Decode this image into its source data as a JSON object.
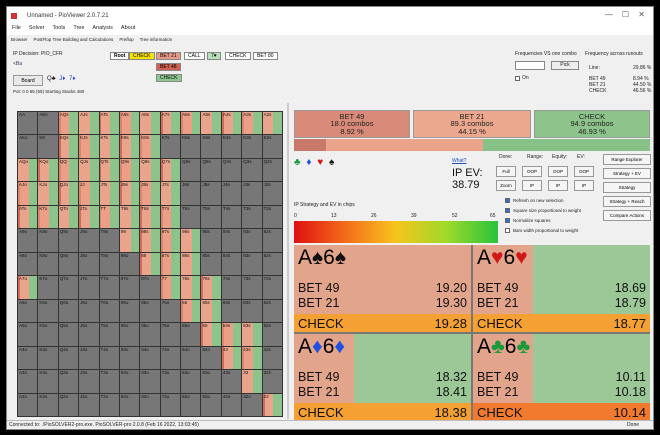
{
  "window": {
    "title": "Unnamed - PioViewer 2.0.7.21",
    "controls": [
      "—",
      "☐",
      "✕"
    ]
  },
  "menu": [
    "File",
    "Solver",
    "Tools",
    "Tree",
    "Analysis",
    "About"
  ],
  "tabs": [
    "Browser",
    "PostFlop Tree Building and Calculations",
    "Preflop",
    "Tree information"
  ],
  "info": {
    "decision": "IP Decision:  PIO_CFR",
    "decision_sub": "<Ba",
    "board_button": "Board",
    "board": [
      {
        "text": "Q♣",
        "color": "#111"
      },
      {
        "text": "J♦",
        "color": "#2040d0"
      },
      {
        "text": "7♦",
        "color": "#2040d0"
      }
    ],
    "pot": "Pot: 0 0 65 (65) Starting Stacks 480"
  },
  "tree": {
    "root": "Root",
    "check1": "CHECK",
    "bet21": "BET 21",
    "call": "CALL",
    "seven_heart": "7♥",
    "check2": "CHECK",
    "bet80": "BET 80",
    "bet48": "BET 48",
    "check3": "CHECK"
  },
  "freq_panel": {
    "header_left": "Frequencies VS one combo",
    "header_right": "Frequency across runouts",
    "pick": "Pick",
    "on": "On",
    "line_label": "Line:",
    "line_value": "29.86 %",
    "rows": [
      {
        "label": "BET 49",
        "value": "8.94 %"
      },
      {
        "label": "BET 21",
        "value": "44.50 %"
      },
      {
        "label": "CHECK",
        "value": "46.56 %"
      }
    ]
  },
  "actions": [
    {
      "label": "BET 49",
      "combos": "18.0 combos",
      "pct": "8.92 %",
      "color": "#d98a78"
    },
    {
      "label": "BET 21",
      "combos": "89.3 combos",
      "pct": "44.15 %",
      "color": "#eba88e"
    },
    {
      "label": "CHECK",
      "combos": "94.9 combos",
      "pct": "46.93 %",
      "color": "#8cc48c"
    }
  ],
  "strip": [
    {
      "frac": 0.09,
      "color": "#c9796a"
    },
    {
      "frac": 0.442,
      "color": "#e9a48b"
    },
    {
      "frac": 0.468,
      "color": "#86c187"
    }
  ],
  "suits": [
    {
      "s": "♣",
      "c": "#1a9a3a"
    },
    {
      "s": "♦",
      "c": "#2050e0"
    },
    {
      "s": "♥",
      "c": "#d01818"
    },
    {
      "s": "♠",
      "c": "#111"
    }
  ],
  "what": "What?",
  "ip_ev_label": "IP EV:",
  "ip_ev_value": "38.79",
  "col_labels": {
    "done": "Done:",
    "range": "Range:",
    "equity": "Equity:",
    "ev": "EV:"
  },
  "buttons": {
    "full": "Full",
    "zoom": "Zoom",
    "oop": "OOP",
    "ip": "IP"
  },
  "right_buttons": [
    "Range Explorer",
    "Strategy + EV",
    "Strategy",
    "Strategy + Reach",
    "Compare Actions"
  ],
  "options": [
    {
      "label": "Refresh on new selection",
      "on": true
    },
    {
      "label": "Square size proportional to weight",
      "on": true
    },
    {
      "label": "Normalize squares",
      "on": true
    },
    {
      "label": "Bars width proportional to weight",
      "on": false
    }
  ],
  "strategy_label": "IP Strategy and EV in chips",
  "ticks": [
    "0",
    "13",
    "26",
    "39",
    "52",
    "65"
  ],
  "hands": [
    {
      "rank": "A",
      "suit": "♠",
      "rank2": "6",
      "suit2": "♠",
      "color": "#111",
      "bet49": "19.20",
      "bet21": "19.30",
      "check": "19.28",
      "bg": "#e09d84",
      "check_bg": "#f5a033"
    },
    {
      "rank": "A",
      "suit": "♥",
      "rank2": "6",
      "suit2": "♥",
      "color": "#d01818",
      "bet49": "18.69",
      "bet21": "18.79",
      "check": "18.77",
      "bg": "#9cc898",
      "check_bg": "#f5a033"
    },
    {
      "rank": "A",
      "suit": "♦",
      "rank2": "6",
      "suit2": "♦",
      "color": "#2050e0",
      "bet49": "18.32",
      "bet21": "18.41",
      "check": "18.38",
      "bg": "#9cc898",
      "check_bg": "#f5a033"
    },
    {
      "rank": "A",
      "suit": "♣",
      "rank2": "6",
      "suit2": "♣",
      "color": "#1a9a3a",
      "bet49": "10.11",
      "bet21": "10.18",
      "check": "10.14",
      "bg": "#9cc898",
      "check_bg": "#f27a2e"
    }
  ],
  "hand_labels": {
    "bet49": "BET 49",
    "bet21": "BET 21",
    "check": "CHECK"
  },
  "grid_labels": [
    [
      "AA",
      "AKs",
      "AQs",
      "AJs",
      "ATs",
      "A9s",
      "A8s",
      "A7s",
      "A6s",
      "A5s",
      "A4s",
      "A3s",
      "A2s"
    ],
    [
      "AKo",
      "KK",
      "KQs",
      "KJs",
      "KTs",
      "K9s",
      "K8s",
      "K7s",
      "K6s",
      "K5s",
      "K4s",
      "K3s",
      "K2s"
    ],
    [
      "AQo",
      "KQo",
      "QQ",
      "QJs",
      "QTs",
      "Q9s",
      "Q8s",
      "Q7s",
      "Q6s",
      "Q5s",
      "Q4s",
      "Q3s",
      "Q2s"
    ],
    [
      "AJo",
      "KJo",
      "QJo",
      "JJ",
      "JTs",
      "J9s",
      "J8s",
      "J7s",
      "J6s",
      "J5s",
      "J4s",
      "J3s",
      "J2s"
    ],
    [
      "ATo",
      "KTo",
      "QTo",
      "JTo",
      "TT",
      "T9s",
      "T8s",
      "T7s",
      "T6s",
      "T5s",
      "T4s",
      "T3s",
      "T2s"
    ],
    [
      "A9o",
      "K9o",
      "Q9o",
      "J9o",
      "T9o",
      "99",
      "98s",
      "97s",
      "96s",
      "95s",
      "94s",
      "93s",
      "92s"
    ],
    [
      "A8o",
      "K8o",
      "Q8o",
      "J8o",
      "T8o",
      "98o",
      "88",
      "87s",
      "86s",
      "85s",
      "84s",
      "83s",
      "82s"
    ],
    [
      "A7o",
      "K7o",
      "Q7o",
      "J7o",
      "T7o",
      "97o",
      "87o",
      "77",
      "76s",
      "75s",
      "74s",
      "73s",
      "72s"
    ],
    [
      "A6o",
      "K6o",
      "Q6o",
      "J6o",
      "T6o",
      "96o",
      "86o",
      "76o",
      "66",
      "65s",
      "64s",
      "63s",
      "62s"
    ],
    [
      "A5o",
      "K5o",
      "Q5o",
      "J5o",
      "T5o",
      "95o",
      "85o",
      "75o",
      "65o",
      "55",
      "54s",
      "53s",
      "52s"
    ],
    [
      "A4o",
      "K4o",
      "Q4o",
      "J4o",
      "T4o",
      "94o",
      "84o",
      "74o",
      "64o",
      "54o",
      "44",
      "43s",
      "42s"
    ],
    [
      "A3o",
      "K3o",
      "Q3o",
      "J3o",
      "T3o",
      "93o",
      "83o",
      "73o",
      "63o",
      "53o",
      "43o",
      "33",
      "32s"
    ],
    [
      "A2o",
      "K2o",
      "Q2o",
      "J2o",
      "T2o",
      "92o",
      "82o",
      "72o",
      "62o",
      "52o",
      "42o",
      "32o",
      "22"
    ]
  ],
  "status": {
    "left": "Connected to: .\\PioSOLVER2-pro.exe. PioSOLVER-pro 2.0.8 (Feb 16 2022, 13:03:45)",
    "right": "Done"
  }
}
